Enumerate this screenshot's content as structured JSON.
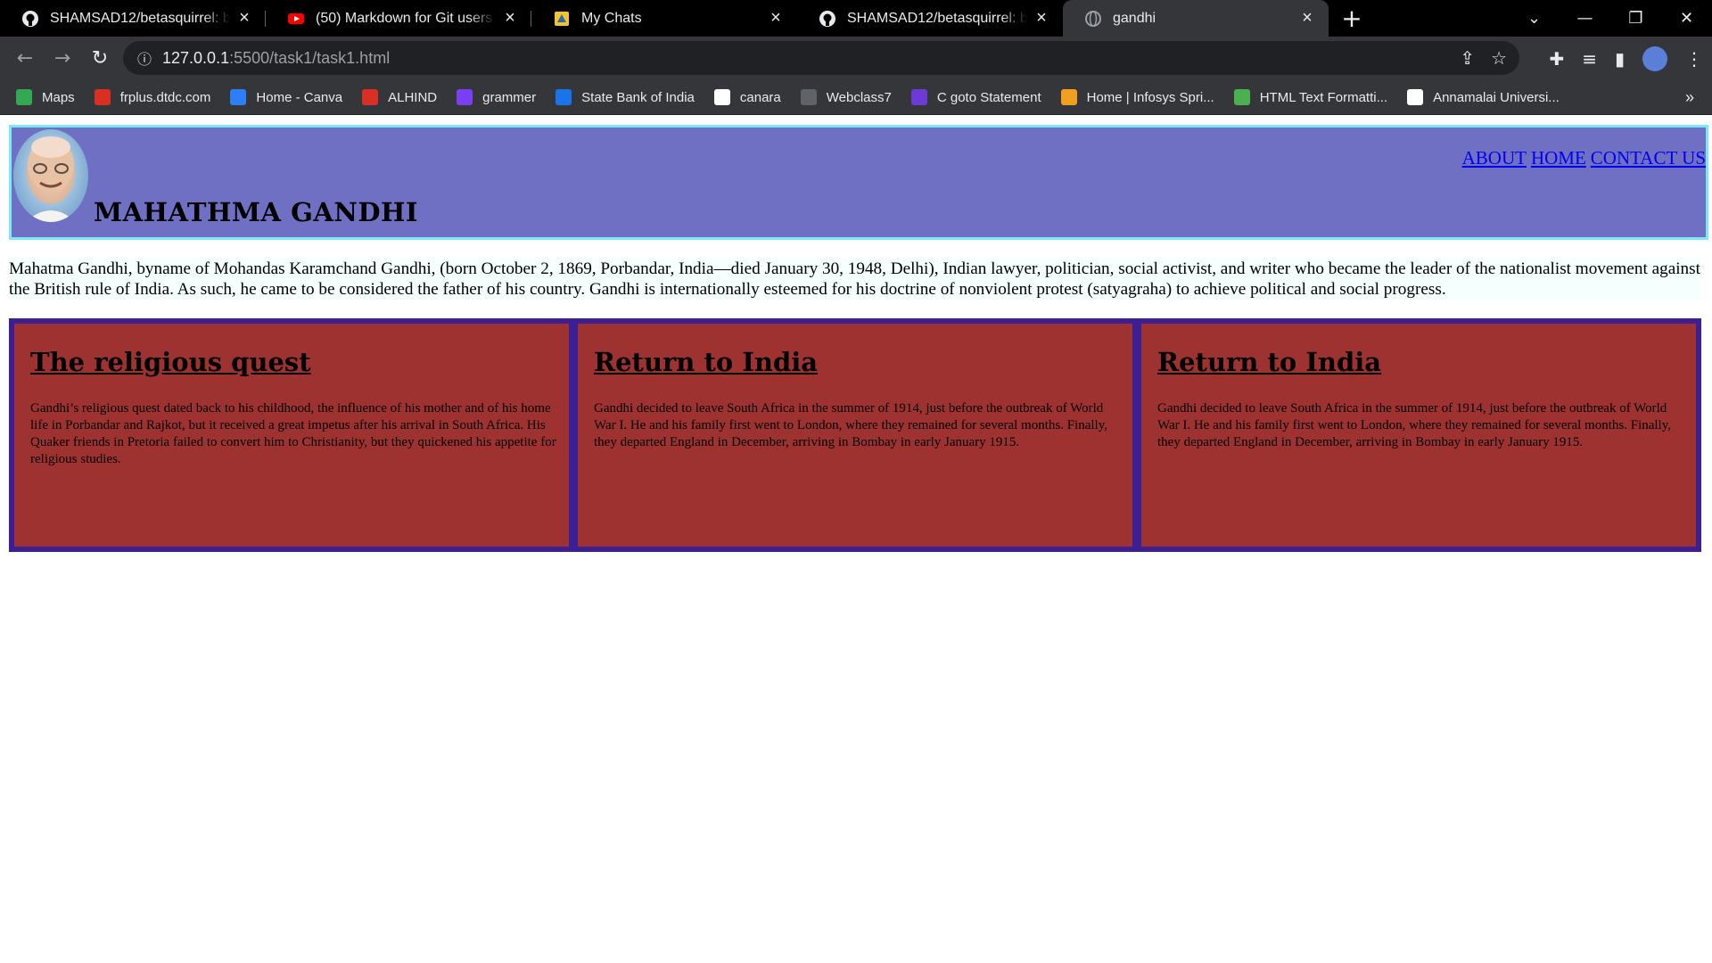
{
  "browser": {
    "tabs": [
      {
        "title": "SHAMSAD12/betasquirrel: betadrop",
        "icon": "github-icon"
      },
      {
        "title": "(50) Markdown for Git users - Markdown",
        "icon": "youtube-icon"
      },
      {
        "title": "My Chats",
        "icon": "chat-icon"
      },
      {
        "title": "SHAMSAD12/betasquirrel: betadrop",
        "icon": "github-icon"
      },
      {
        "title": "gandhi",
        "icon": "globe-icon",
        "active": true
      }
    ],
    "url_host": "127.0.0.1",
    "url_path": ":5500/task1/task1.html",
    "bookmarks": [
      {
        "label": "Maps",
        "color": "#34a853"
      },
      {
        "label": "frplus.dtdc.com",
        "color": "#d93025"
      },
      {
        "label": "Home - Canva",
        "color": "#2d7ff9"
      },
      {
        "label": "ALHIND",
        "color": "#d93025"
      },
      {
        "label": "grammer",
        "color": "#7b3ff2"
      },
      {
        "label": "State Bank of India",
        "color": "#1a73e8"
      },
      {
        "label": "canara",
        "color": "#ffffff"
      },
      {
        "label": "Webclass7",
        "color": "#5f6368"
      },
      {
        "label": "C goto Statement",
        "color": "#6c3bd6"
      },
      {
        "label": "Home | Infosys Spri...",
        "color": "#f0a020"
      },
      {
        "label": "HTML Text Formatti...",
        "color": "#4caf50"
      },
      {
        "label": "Annamalai Universi...",
        "color": "#ffffff"
      }
    ],
    "more_label": "»"
  },
  "page": {
    "title": "MAHATHMA GANDHI",
    "nav": [
      "ABOUT",
      "HOME",
      "CONTACT US"
    ],
    "intro": "Mahatma Gandhi, byname of Mohandas Karamchand Gandhi, (born October 2, 1869, Porbandar, India—died January 30, 1948, Delhi), Indian lawyer, politician, social activist, and writer who became the leader of the nationalist movement against the British rule of India. As such, he came to be considered the father of his country. Gandhi is internationally esteemed for his doctrine of nonviolent protest (satyagraha) to achieve political and social progress.",
    "cards": [
      {
        "heading": "The religious quest",
        "body": "Gandhi’s religious quest dated back to his childhood, the influence of his mother and of his home life in Porbandar and Rajkot, but it received a great impetus after his arrival in South Africa. His Quaker friends in Pretoria failed to convert him to Christianity, but they quickened his appetite for religious studies."
      },
      {
        "heading": "Return to India",
        "body": "Gandhi decided to leave South Africa in the summer of 1914, just before the outbreak of World War I. He and his family first went to London, where they remained for several months. Finally, they departed England in December, arriving in Bombay in early January 1915."
      },
      {
        "heading": "Return to India",
        "body": "Gandhi decided to leave South Africa in the summer of 1914, just before the outbreak of World War I. He and his family first went to London, where they remained for several months. Finally, they departed England in December, arriving in Bombay in early January 1915."
      }
    ],
    "colors": {
      "header_bg": "#6f6fc4",
      "header_border": "#7be8ff",
      "cards_bg": "#3c1f93",
      "card_bg": "#9d3230",
      "link": "#0000ee"
    }
  }
}
